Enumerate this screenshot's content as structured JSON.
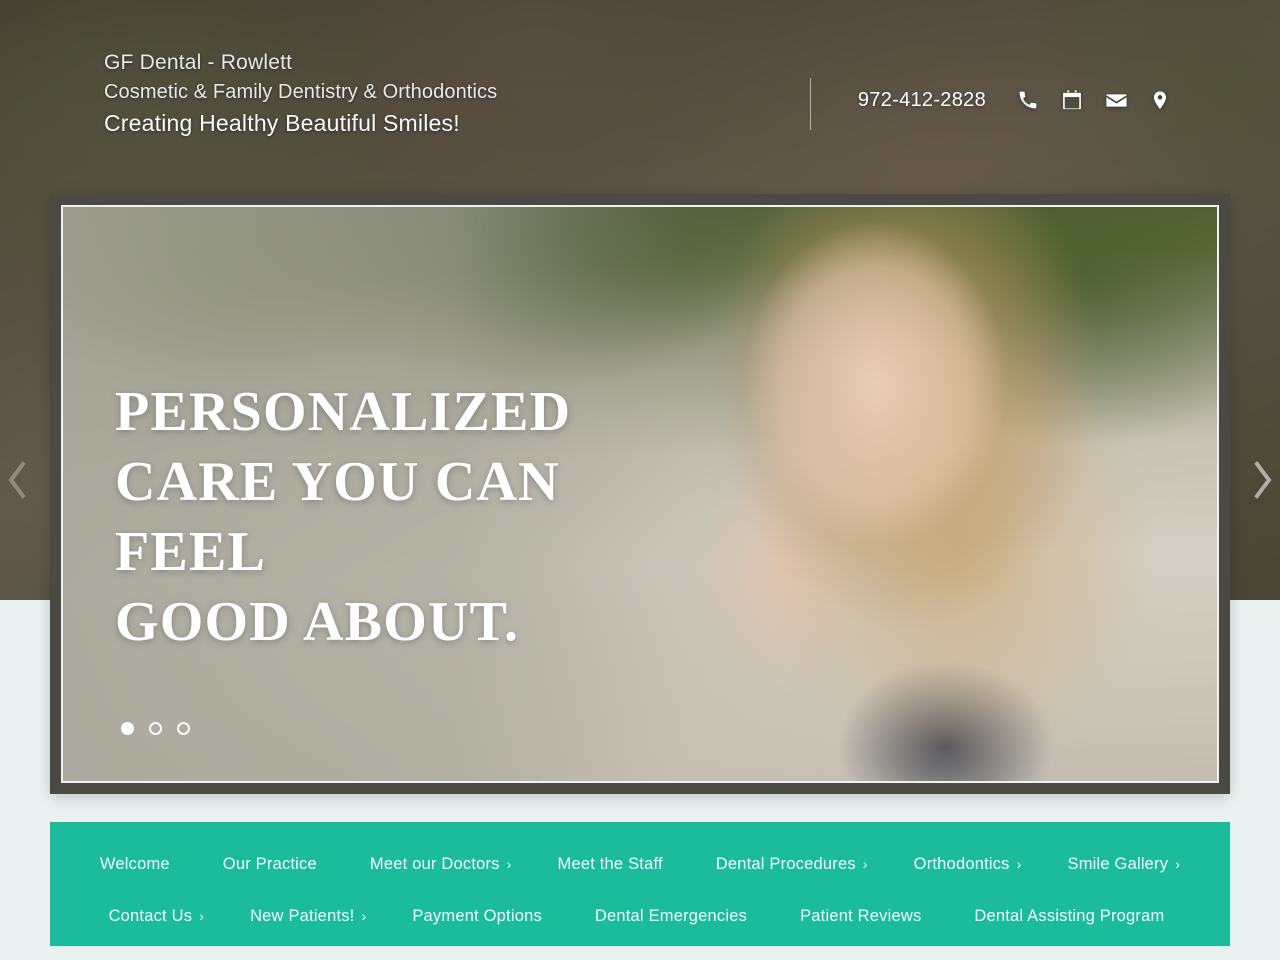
{
  "header": {
    "brand_line1": "GF Dental - Rowlett",
    "brand_line2": "Cosmetic & Family Dentistry & Orthodontics",
    "brand_line3": "Creating Healthy Beautiful Smiles!",
    "phone": "972-412-2828",
    "icons": [
      {
        "name": "phone-icon",
        "label": "Call"
      },
      {
        "name": "calendar-icon",
        "label": "Request Appointment"
      },
      {
        "name": "envelope-icon",
        "label": "Email Us"
      },
      {
        "name": "map-pin-icon",
        "label": "Find Us"
      }
    ]
  },
  "hero": {
    "title_line1": "PERSONALIZED",
    "title_line2": "CARE YOU CAN FEEL",
    "title_line3": "GOOD ABOUT.",
    "slides": [
      {
        "active": true
      },
      {
        "active": false
      },
      {
        "active": false
      }
    ],
    "prev_label": "‹",
    "next_label": "›"
  },
  "nav": {
    "row1": [
      {
        "label": "Welcome",
        "caret": ""
      },
      {
        "label": "Our Practice",
        "caret": ""
      },
      {
        "label": "Meet our Doctors",
        "caret": "›"
      },
      {
        "label": "Meet the Staff",
        "caret": ""
      },
      {
        "label": "Dental Procedures",
        "caret": "›"
      },
      {
        "label": "Orthodontics",
        "caret": "›"
      },
      {
        "label": "Smile Gallery",
        "caret": "›"
      }
    ],
    "row2": [
      {
        "label": "Contact Us",
        "caret": "›"
      },
      {
        "label": "New Patients!",
        "caret": "›"
      },
      {
        "label": "Payment Options",
        "caret": ""
      },
      {
        "label": "Dental Emergencies",
        "caret": ""
      },
      {
        "label": "Patient Reviews",
        "caret": ""
      },
      {
        "label": "Dental Assisting Program",
        "caret": ""
      }
    ]
  },
  "colors": {
    "nav_teal": "#1abc9c",
    "page_background": "#eaf1f1",
    "frame_dark": "#4a4a42",
    "text_white": "#ffffff"
  }
}
